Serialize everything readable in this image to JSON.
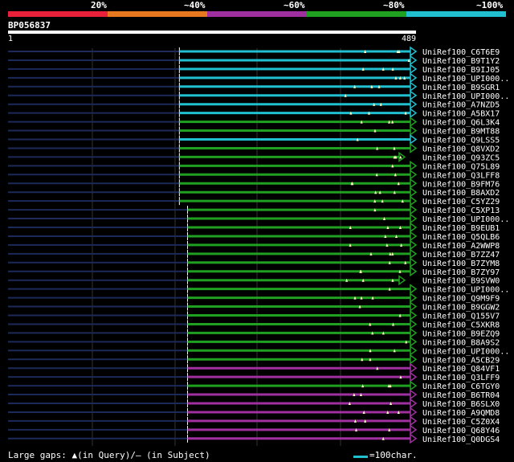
{
  "legend": {
    "labels": [
      "20%",
      "~40%",
      "~60%",
      "~80%",
      "~100%"
    ],
    "colors": [
      "#e8203a",
      "#e87820",
      "#a030a0",
      "#20a020",
      "#20c0d0"
    ]
  },
  "query": {
    "title": "BP056837",
    "start_label": "1",
    "end_label": "489"
  },
  "footer": {
    "gaps_text": "Large gaps: ▲(in Query)/– (in Subject)",
    "scale_text": "=100char."
  },
  "hits": [
    {
      "name": "UniRef100_C6T6E9",
      "tier": 4,
      "start": 0.42,
      "arrow": true
    },
    {
      "name": "UniRef100_B9T1Y2",
      "tier": 4,
      "start": 0.42,
      "arrow": true
    },
    {
      "name": "UniRef100_B9IJ05",
      "tier": 4,
      "start": 0.42,
      "arrow": true
    },
    {
      "name": "UniRef100_UPI000..",
      "tier": 4,
      "start": 0.42,
      "arrow": true
    },
    {
      "name": "UniRef100_B9SGR1",
      "tier": 4,
      "start": 0.42,
      "arrow": true
    },
    {
      "name": "UniRef100_UPI000..",
      "tier": 4,
      "start": 0.42,
      "arrow": true
    },
    {
      "name": "UniRef100_A7NZD5",
      "tier": 4,
      "start": 0.42,
      "arrow": true
    },
    {
      "name": "UniRef100_A5BX17",
      "tier": 4,
      "start": 0.42,
      "arrow": true
    },
    {
      "name": "UniRef100_Q6L3K4",
      "tier": 3,
      "start": 0.42,
      "arrow": true
    },
    {
      "name": "UniRef100_B9MT88",
      "tier": 3,
      "start": 0.42,
      "arrow": true
    },
    {
      "name": "UniRef100_Q9LSS5",
      "tier": 4,
      "start": 0.42,
      "arrow": true
    },
    {
      "name": "UniRef100_Q8VXD2",
      "tier": 3,
      "start": 0.42,
      "arrow": true
    },
    {
      "name": "UniRef100_Q93ZC5",
      "tier": 3,
      "start": 0.42,
      "arrow": true,
      "short": true
    },
    {
      "name": "UniRef100_Q75L89",
      "tier": 3,
      "start": 0.42,
      "arrow": true
    },
    {
      "name": "UniRef100_Q3LFF8",
      "tier": 3,
      "start": 0.42,
      "arrow": true
    },
    {
      "name": "UniRef100_B9FM76",
      "tier": 3,
      "start": 0.42,
      "arrow": true
    },
    {
      "name": "UniRef100_B8AXD2",
      "tier": 3,
      "start": 0.42,
      "arrow": true
    },
    {
      "name": "UniRef100_C5YZ29",
      "tier": 3,
      "start": 0.42,
      "arrow": true
    },
    {
      "name": "UniRef100_C5XP13",
      "tier": 3,
      "start": 0.44,
      "arrow": true
    },
    {
      "name": "UniRef100_UPI000..",
      "tier": 3,
      "start": 0.44,
      "arrow": true
    },
    {
      "name": "UniRef100_B9EUB1",
      "tier": 3,
      "start": 0.44,
      "arrow": true
    },
    {
      "name": "UniRef100_Q5QLB6",
      "tier": 3,
      "start": 0.44,
      "arrow": true
    },
    {
      "name": "UniRef100_A2WWP8",
      "tier": 3,
      "start": 0.44,
      "arrow": true
    },
    {
      "name": "UniRef100_B7ZZ47",
      "tier": 3,
      "start": 0.44,
      "arrow": true
    },
    {
      "name": "UniRef100_B7ZYM8",
      "tier": 3,
      "start": 0.44,
      "arrow": true
    },
    {
      "name": "UniRef100_B7ZY97",
      "tier": 3,
      "start": 0.44,
      "arrow": true
    },
    {
      "name": "UniRef100_B9SVW0",
      "tier": 3,
      "start": 0.44,
      "arrow": true,
      "short": true
    },
    {
      "name": "UniRef100_UPI000..",
      "tier": 3,
      "start": 0.44,
      "arrow": true
    },
    {
      "name": "UniRef100_Q9M9F9",
      "tier": 3,
      "start": 0.44,
      "arrow": true
    },
    {
      "name": "UniRef100_B9GGW2",
      "tier": 3,
      "start": 0.44,
      "arrow": true
    },
    {
      "name": "UniRef100_Q155V7",
      "tier": 3,
      "start": 0.44,
      "arrow": true
    },
    {
      "name": "UniRef100_C5XKR8",
      "tier": 3,
      "start": 0.44,
      "arrow": true
    },
    {
      "name": "UniRef100_B9EZQ9",
      "tier": 3,
      "start": 0.44,
      "arrow": true
    },
    {
      "name": "UniRef100_B8A9S2",
      "tier": 3,
      "start": 0.44,
      "arrow": true
    },
    {
      "name": "UniRef100_UPI000..",
      "tier": 3,
      "start": 0.44,
      "arrow": true
    },
    {
      "name": "UniRef100_A5CB29",
      "tier": 3,
      "start": 0.44,
      "arrow": true
    },
    {
      "name": "UniRef100_Q84VF1",
      "tier": 2,
      "start": 0.44,
      "arrow": true
    },
    {
      "name": "UniRef100_Q3LFF9",
      "tier": 2,
      "start": 0.44,
      "arrow": true
    },
    {
      "name": "UniRef100_C6TGY0",
      "tier": 3,
      "start": 0.44,
      "arrow": true
    },
    {
      "name": "UniRef100_B6TR04",
      "tier": 2,
      "start": 0.44,
      "arrow": true
    },
    {
      "name": "UniRef100_B6SLX0",
      "tier": 2,
      "start": 0.44,
      "arrow": true
    },
    {
      "name": "UniRef100_A9QMD8",
      "tier": 2,
      "start": 0.44,
      "arrow": true
    },
    {
      "name": "UniRef100_C5Z0X4",
      "tier": 2,
      "start": 0.44,
      "arrow": true
    },
    {
      "name": "UniRef100_Q68Y46",
      "tier": 2,
      "start": 0.44,
      "arrow": true
    },
    {
      "name": "UniRef100_Q0DGS4",
      "tier": 2,
      "start": 0.44,
      "arrow": true
    }
  ]
}
